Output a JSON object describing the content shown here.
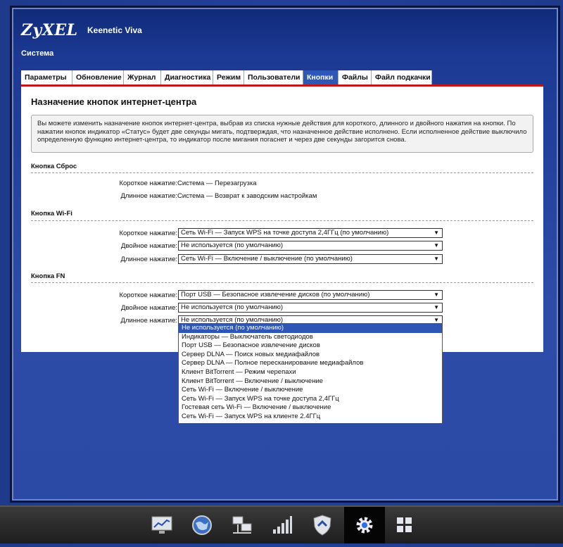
{
  "header": {
    "brand": "ZyXEL",
    "model": "Keenetic Viva",
    "section": "Система"
  },
  "tabs": [
    {
      "label": "Параметры"
    },
    {
      "label": "Обновление"
    },
    {
      "label": "Журнал"
    },
    {
      "label": "Диагностика"
    },
    {
      "label": "Режим"
    },
    {
      "label": "Пользователи"
    },
    {
      "label": "Кнопки",
      "active": true
    },
    {
      "label": "Файлы"
    },
    {
      "label": "Файл подкачки"
    }
  ],
  "panel": {
    "title": "Назначение кнопок интернет-центра",
    "info": "Вы можете изменить назначение кнопок интернет-центра, выбрав из списка нужные действия для короткого, длинного и двойного нажатия на кнопки. По нажатии кнопок индикатор «Статус» будет две секунды мигать, подтверждая, что назначенное действие исполнено. Если исполненное действие выключило определенную функцию интернет-центра, то индикатор после мигания погаснет и через две секунды загорится снова."
  },
  "reset_group": {
    "title": "Кнопка Сброс",
    "short_label": "Короткое нажатие:",
    "short_value": "Система — Перезагрузка",
    "long_label": "Длинное нажатие:",
    "long_value": "Система — Возврат к заводским настройкам"
  },
  "wifi_group": {
    "title": "Кнопка Wi-Fi",
    "short_label": "Короткое нажатие:",
    "short_value": "Сеть Wi-Fi — Запуск WPS на точке доступа 2,4ГГц (по умолчанию)",
    "double_label": "Двойное нажатие:",
    "double_value": "Не используется (по умолчанию)",
    "long_label": "Длинное нажатие:",
    "long_value": "Сеть Wi-Fi — Включение / выключение (по умолчанию)"
  },
  "fn_group": {
    "title": "Кнопка FN",
    "short_label": "Короткое нажатие:",
    "short_value": "Порт USB — Безопасное извлечение дисков (по умолчанию)",
    "double_label": "Двойное нажатие:",
    "double_value": "Не используется (по умолчанию)",
    "long_label": "Длинное нажатие:",
    "long_value": "Не используется (по умолчанию)"
  },
  "dropdown_options": [
    "Не используется (по умолчанию)",
    "Индикаторы — Выключатель светодиодов",
    "Порт USB — Безопасное извлечение дисков",
    "Сервер DLNA — Поиск новых медиафайлов",
    "Сервер DLNA — Полное пересканирование медиафайлов",
    "Клиент BitTorrent — Режим черепахи",
    "Клиент BitTorrent — Включение / выключение",
    "Сеть Wi-Fi — Включение / выключение",
    "Сеть Wi-Fi — Запуск WPS на точке доступа 2,4ГГц",
    "Гостевая сеть Wi-Fi — Включение / выключение",
    "Сеть Wi-Fi — Запуск WPS на клиенте 2.4ГГц"
  ],
  "bottom_nav": [
    {
      "icon": "monitor-chart-icon"
    },
    {
      "icon": "globe-icon"
    },
    {
      "icon": "network-computers-icon"
    },
    {
      "icon": "signal-bars-icon"
    },
    {
      "icon": "shield-icon"
    },
    {
      "icon": "gear-icon",
      "active": true
    },
    {
      "icon": "apps-grid-icon"
    }
  ],
  "colors": {
    "accent": "#2d57b8",
    "panel_border": "#c01818",
    "highlight": "#2f55b5"
  }
}
